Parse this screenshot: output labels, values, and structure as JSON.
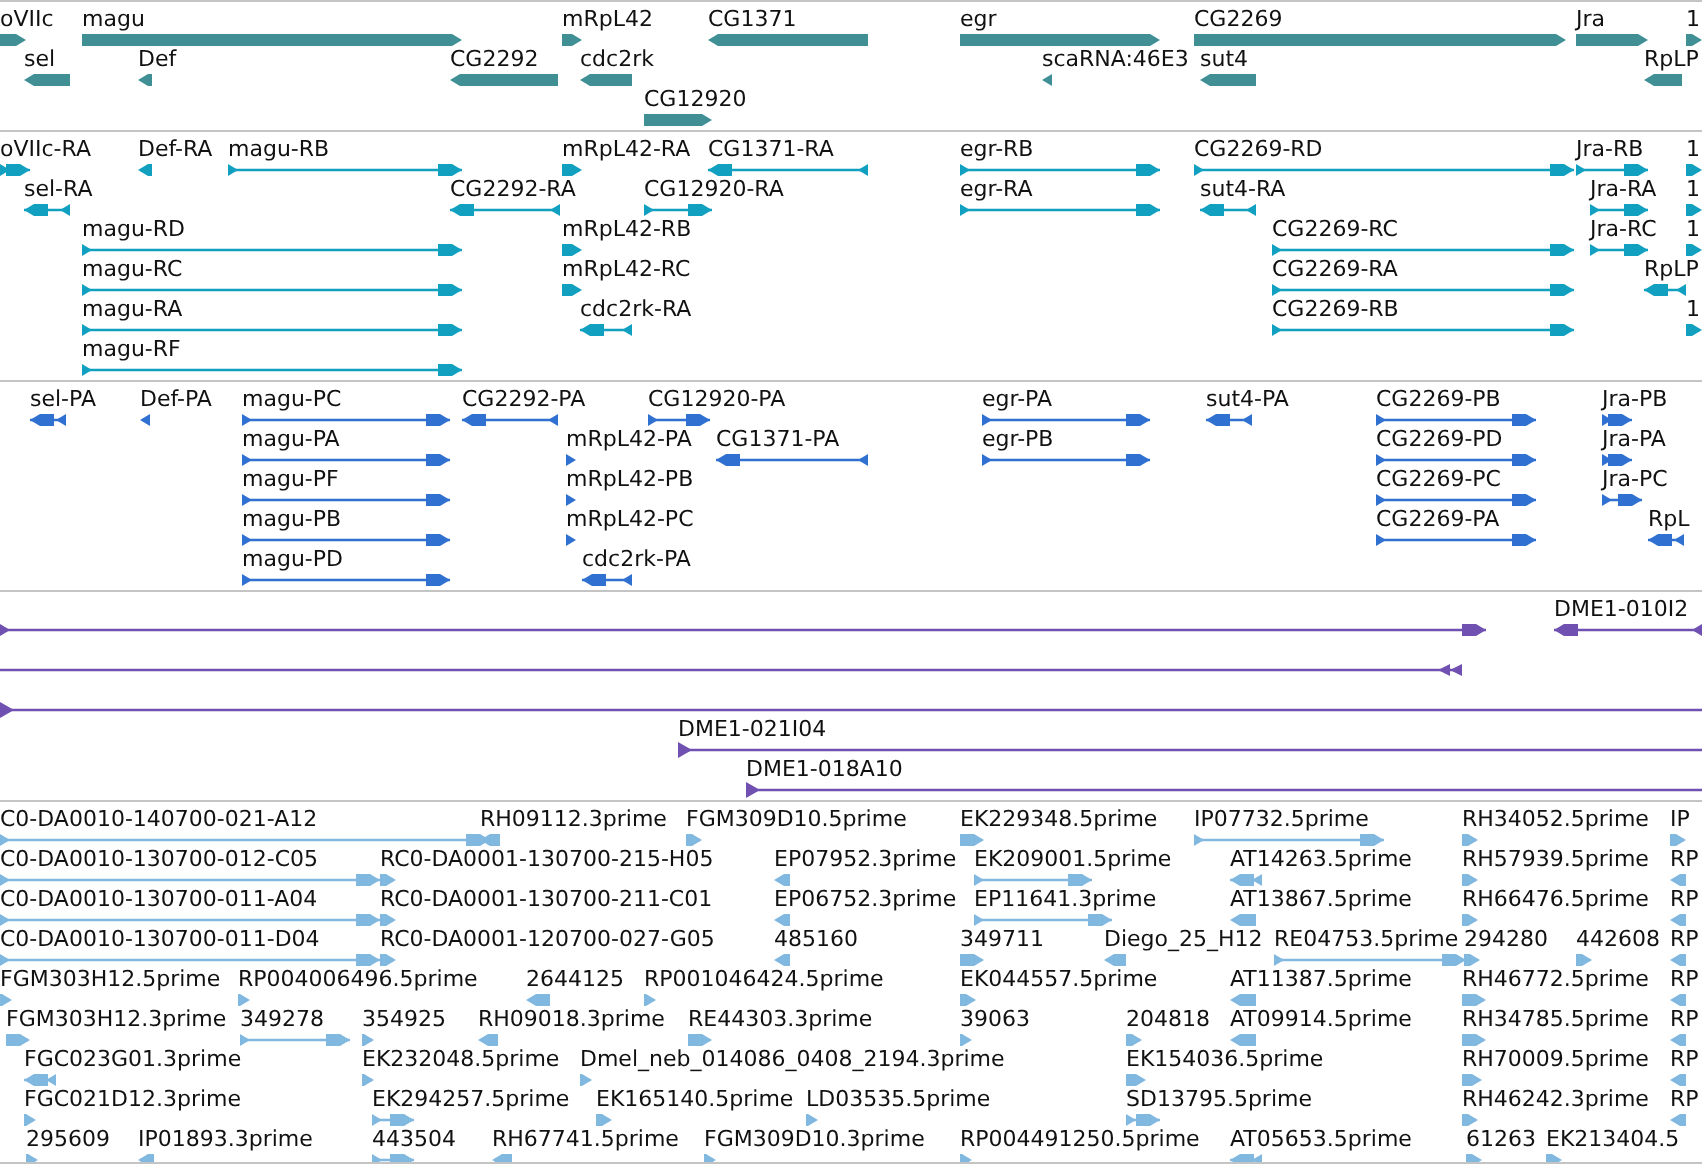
{
  "tracks": [
    {
      "kind": "gene",
      "color": "#3f8f95",
      "rows": [
        {
          "features": [
            {
              "label": "oVIIc",
              "reverse": false
            },
            {
              "label": "magu",
              "reverse": false
            },
            {
              "label": "mRpL42",
              "reverse": false
            },
            {
              "label": "CG1371",
              "reverse": true
            },
            {
              "label": "egr",
              "reverse": false
            },
            {
              "label": "CG2269",
              "reverse": false
            },
            {
              "label": "Jra",
              "reverse": false
            },
            {
              "label": "1",
              "reverse": false
            }
          ]
        },
        {
          "features": [
            {
              "label": "sel",
              "reverse": true
            },
            {
              "label": "Def",
              "reverse": true
            },
            {
              "label": "CG2292",
              "reverse": true
            },
            {
              "label": "cdc2rk",
              "reverse": true
            },
            {
              "label": "scaRNA:46E3",
              "reverse": true
            },
            {
              "label": "sut4",
              "reverse": true
            },
            {
              "label": "RpLP",
              "reverse": true
            }
          ]
        },
        {
          "features": [
            {
              "label": "CG12920",
              "reverse": false
            }
          ]
        }
      ]
    },
    {
      "kind": "transcript",
      "color": "#12a0c0",
      "rows": [
        {
          "features": [
            {
              "label": "oVIIc-RA",
              "reverse": false
            },
            {
              "label": "Def-RA",
              "reverse": true
            },
            {
              "label": "magu-RB",
              "reverse": false
            },
            {
              "label": "mRpL42-RA",
              "reverse": false
            },
            {
              "label": "CG1371-RA",
              "reverse": true
            },
            {
              "label": "egr-RB",
              "reverse": false
            },
            {
              "label": "CG2269-RD",
              "reverse": false
            },
            {
              "label": "Jra-RB",
              "reverse": false
            },
            {
              "label": "1",
              "reverse": false
            }
          ]
        },
        {
          "features": [
            {
              "label": "sel-RA",
              "reverse": true
            },
            {
              "label": "CG2292-RA",
              "reverse": true
            },
            {
              "label": "CG12920-RA",
              "reverse": false
            },
            {
              "label": "egr-RA",
              "reverse": false
            },
            {
              "label": "sut4-RA",
              "reverse": true
            },
            {
              "label": "Jra-RA",
              "reverse": false
            },
            {
              "label": "1",
              "reverse": false
            }
          ]
        },
        {
          "features": [
            {
              "label": "magu-RD",
              "reverse": false
            },
            {
              "label": "mRpL42-RB",
              "reverse": false
            },
            {
              "label": "CG2269-RC",
              "reverse": false
            },
            {
              "label": "Jra-RC",
              "reverse": false
            },
            {
              "label": "1",
              "reverse": false
            }
          ]
        },
        {
          "features": [
            {
              "label": "magu-RC",
              "reverse": false
            },
            {
              "label": "mRpL42-RC",
              "reverse": false
            },
            {
              "label": "CG2269-RA",
              "reverse": false
            },
            {
              "label": "RpLP",
              "reverse": true
            }
          ]
        },
        {
          "features": [
            {
              "label": "magu-RA",
              "reverse": false
            },
            {
              "label": "cdc2rk-RA",
              "reverse": true
            },
            {
              "label": "CG2269-RB",
              "reverse": false
            },
            {
              "label": "1",
              "reverse": false
            }
          ]
        },
        {
          "features": [
            {
              "label": "magu-RF",
              "reverse": false
            }
          ]
        }
      ]
    },
    {
      "kind": "protein",
      "color": "#3070d0",
      "rows": [
        {
          "features": [
            {
              "label": "sel-PA",
              "reverse": true
            },
            {
              "label": "Def-PA",
              "reverse": true
            },
            {
              "label": "magu-PC",
              "reverse": false
            },
            {
              "label": "CG2292-PA",
              "reverse": true
            },
            {
              "label": "CG12920-PA",
              "reverse": false
            },
            {
              "label": "egr-PA",
              "reverse": false
            },
            {
              "label": "sut4-PA",
              "reverse": true
            },
            {
              "label": "CG2269-PB",
              "reverse": false
            },
            {
              "label": "Jra-PB",
              "reverse": false
            }
          ]
        },
        {
          "features": [
            {
              "label": "magu-PA",
              "reverse": false
            },
            {
              "label": "mRpL42-PA",
              "reverse": false
            },
            {
              "label": "CG1371-PA",
              "reverse": true
            },
            {
              "label": "egr-PB",
              "reverse": false
            },
            {
              "label": "CG2269-PD",
              "reverse": false
            },
            {
              "label": "Jra-PA",
              "reverse": false
            }
          ]
        },
        {
          "features": [
            {
              "label": "magu-PF",
              "reverse": false
            },
            {
              "label": "mRpL42-PB",
              "reverse": false
            },
            {
              "label": "CG2269-PC",
              "reverse": false
            },
            {
              "label": "Jra-PC",
              "reverse": false
            }
          ]
        },
        {
          "features": [
            {
              "label": "magu-PB",
              "reverse": false
            },
            {
              "label": "mRpL42-PC",
              "reverse": false
            },
            {
              "label": "CG2269-PA",
              "reverse": false
            },
            {
              "label": "RpL",
              "reverse": true
            }
          ]
        },
        {
          "features": [
            {
              "label": "magu-PD",
              "reverse": false
            },
            {
              "label": "cdc2rk-PA",
              "reverse": true
            }
          ]
        }
      ]
    },
    {
      "kind": "clone",
      "color": "#7050b0",
      "rows": [
        {
          "features": [
            {
              "reverse": false
            },
            {
              "label": "DME1-010I2",
              "reverse": true
            }
          ]
        },
        {
          "features": [
            {
              "reverse": true
            }
          ]
        },
        {
          "features": [
            {
              "reverse": false
            }
          ]
        },
        {
          "features": [
            {
              "label": "DME1-021I04",
              "reverse": false
            }
          ]
        },
        {
          "features": [
            {
              "label": "DME1-018A10",
              "reverse": false
            }
          ]
        }
      ]
    },
    {
      "kind": "est",
      "color": "#80b8e0",
      "rows": [
        {
          "features": [
            {
              "label": "C0-DA0010-140700-021-A12",
              "reverse": false
            },
            {
              "label": "RH09112.3prime",
              "reverse": true
            },
            {
              "label": "FGM309D10.5prime",
              "reverse": false
            },
            {
              "label": "EK229348.5prime",
              "reverse": false
            },
            {
              "label": "IP07732.5prime",
              "reverse": false
            },
            {
              "label": "RH34052.5prime",
              "reverse": false
            },
            {
              "label": "IP",
              "reverse": false
            }
          ]
        },
        {
          "features": [
            {
              "label": "C0-DA0010-130700-012-C05",
              "reverse": false
            },
            {
              "label": "RC0-DA0001-130700-215-H05",
              "reverse": false
            },
            {
              "label": "EP07952.3prime",
              "reverse": true
            },
            {
              "label": "EK209001.5prime",
              "reverse": false
            },
            {
              "label": "AT14263.5prime",
              "reverse": true
            },
            {
              "label": "RH57939.5prime",
              "reverse": false
            },
            {
              "label": "RP",
              "reverse": true
            }
          ]
        },
        {
          "features": [
            {
              "label": "C0-DA0010-130700-011-A04",
              "reverse": false
            },
            {
              "label": "RC0-DA0001-130700-211-C01",
              "reverse": false
            },
            {
              "label": "EP06752.3prime",
              "reverse": true
            },
            {
              "label": "EP11641.3prime",
              "reverse": false
            },
            {
              "label": "AT13867.5prime",
              "reverse": true
            },
            {
              "label": "RH66476.5prime",
              "reverse": false
            },
            {
              "label": "RP",
              "reverse": true
            }
          ]
        },
        {
          "features": [
            {
              "label": "C0-DA0010-130700-011-D04",
              "reverse": false
            },
            {
              "label": "RC0-DA0001-120700-027-G05",
              "reverse": false
            },
            {
              "label": "485160",
              "reverse": true
            },
            {
              "label": "349711",
              "reverse": false
            },
            {
              "label": "Diego_25_H12",
              "reverse": true
            },
            {
              "label": "RE04753.5prime",
              "reverse": false
            },
            {
              "label": "294280",
              "reverse": false
            },
            {
              "label": "442608",
              "reverse": false
            },
            {
              "label": "RP",
              "reverse": true
            }
          ]
        },
        {
          "features": [
            {
              "label": "FGM303H12.5prime",
              "reverse": false
            },
            {
              "label": "RP004006496.5prime",
              "reverse": false
            },
            {
              "label": "2644125",
              "reverse": true
            },
            {
              "label": "RP001046424.5prime",
              "reverse": false
            },
            {
              "label": "EK044557.5prime",
              "reverse": false
            },
            {
              "label": "AT11387.5prime",
              "reverse": true
            },
            {
              "label": "RH46772.5prime",
              "reverse": false
            },
            {
              "label": "RP",
              "reverse": true
            }
          ]
        },
        {
          "features": [
            {
              "label": "FGM303H12.3prime",
              "reverse": false
            },
            {
              "label": "349278",
              "reverse": false
            },
            {
              "label": "354925",
              "reverse": false
            },
            {
              "label": "RH09018.3prime",
              "reverse": true
            },
            {
              "label": "RE44303.3prime",
              "reverse": false
            },
            {
              "label": "39063",
              "reverse": false
            },
            {
              "label": "204818",
              "reverse": false
            },
            {
              "label": "AT09914.5prime",
              "reverse": true
            },
            {
              "label": "RH34785.5prime",
              "reverse": false
            },
            {
              "label": "RP",
              "reverse": true
            }
          ]
        },
        {
          "features": [
            {
              "label": "FGC023G01.3prime",
              "reverse": true
            },
            {
              "label": "EK232048.5prime",
              "reverse": false
            },
            {
              "label": "Dmel_neb_014086_0408_2194.3prime",
              "reverse": false
            },
            {
              "label": "EK154036.5prime",
              "reverse": false
            },
            {
              "label": "RH70009.5prime",
              "reverse": false
            },
            {
              "label": "RP",
              "reverse": true
            }
          ]
        },
        {
          "features": [
            {
              "label": "FGC021D12.3prime",
              "reverse": false
            },
            {
              "label": "EK294257.5prime",
              "reverse": false
            },
            {
              "label": "EK165140.5prime",
              "reverse": false
            },
            {
              "label": "LD03535.5prime",
              "reverse": false
            },
            {
              "label": "SD13795.5prime",
              "reverse": false
            },
            {
              "label": "RH46242.3prime",
              "reverse": false
            },
            {
              "label": "RP",
              "reverse": true
            }
          ]
        },
        {
          "features": [
            {
              "label": "295609",
              "reverse": false
            },
            {
              "label": "IP01893.3prime",
              "reverse": true
            },
            {
              "label": "443504",
              "reverse": false
            },
            {
              "label": "RH67741.5prime",
              "reverse": true
            },
            {
              "label": "FGM309D10.3prime",
              "reverse": false
            },
            {
              "label": "RP004491250.5prime",
              "reverse": false
            },
            {
              "label": "AT05653.5prime",
              "reverse": true
            },
            {
              "label": "61263",
              "reverse": false
            },
            {
              "label": "EK213404.5",
              "reverse": false
            }
          ]
        }
      ]
    }
  ]
}
